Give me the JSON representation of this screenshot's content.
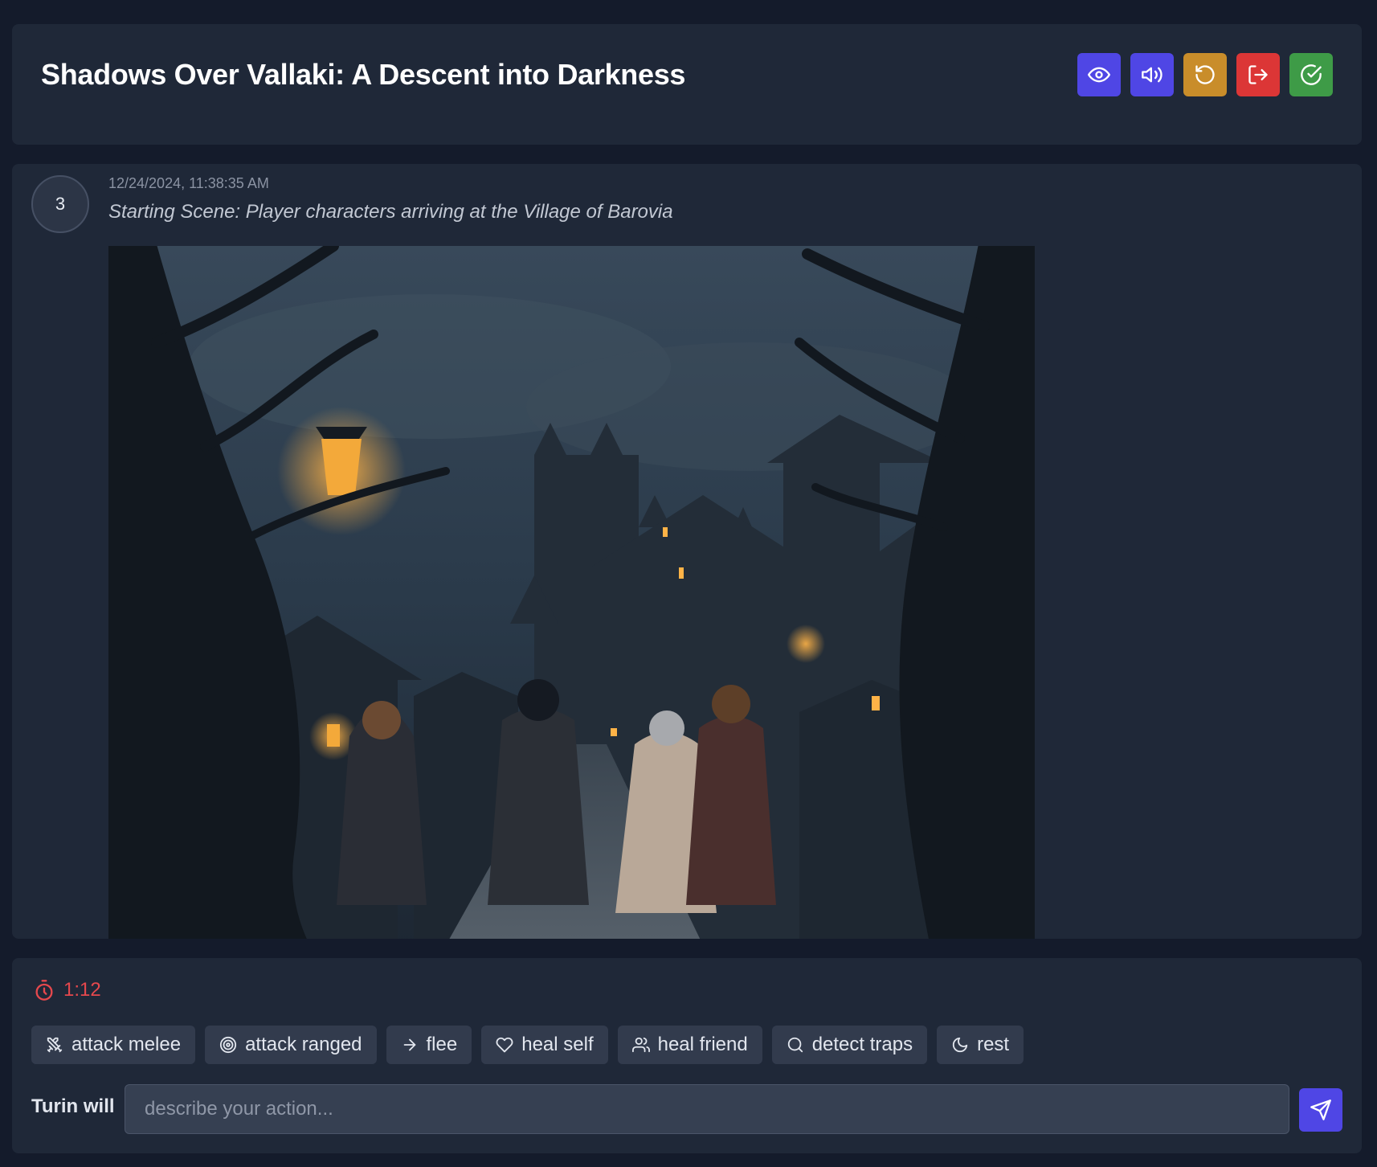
{
  "header": {
    "title": "Shadows Over Vallaki: A Descent into Darkness",
    "buttons": [
      {
        "icon": "eye-icon",
        "color": "#4f46e5"
      },
      {
        "icon": "speaker-icon",
        "color": "#4f46e5"
      },
      {
        "icon": "undo-icon",
        "color": "#c98d2a"
      },
      {
        "icon": "exit-icon",
        "color": "#dc3636"
      },
      {
        "icon": "check-circle-icon",
        "color": "#3e9b47"
      }
    ]
  },
  "feed": {
    "entry": {
      "turn": "3",
      "timestamp": "12/24/2024, 11:38:35 AM",
      "scene_text": "Starting Scene: Player characters arriving at the Village of Barovia"
    }
  },
  "panel": {
    "timer": {
      "icon": "stopwatch-icon",
      "value": "1:12",
      "color": "#e5484d"
    },
    "actions": [
      {
        "label": "attack melee",
        "icon": "swords-icon"
      },
      {
        "label": "attack ranged",
        "icon": "target-icon"
      },
      {
        "label": "flee",
        "icon": "arrow-right-icon"
      },
      {
        "label": "heal self",
        "icon": "heart-icon"
      },
      {
        "label": "heal friend",
        "icon": "users-icon"
      },
      {
        "label": "detect traps",
        "icon": "search-icon"
      },
      {
        "label": "rest",
        "icon": "moon-icon"
      }
    ],
    "input": {
      "label": "Turin will",
      "placeholder": "describe your action...",
      "value": ""
    },
    "send": {
      "icon": "send-icon",
      "color": "#4f46e5"
    }
  }
}
